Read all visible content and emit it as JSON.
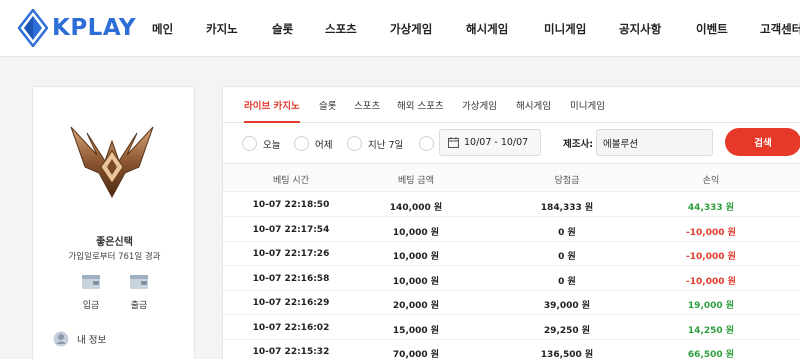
{
  "header": {
    "logo_text": "KPLAY",
    "nav": [
      "메인",
      "카지노",
      "슬롯",
      "스포츠",
      "가상게임",
      "해시게임",
      "미니게임",
      "공지사항",
      "이벤트",
      "고객센터"
    ]
  },
  "profile": {
    "nickname": "좋은신택",
    "since_text": "가입일로부터 761일 경과",
    "deposit_label": "입금",
    "withdraw_label": "출금",
    "my_info_label": "내 정보"
  },
  "tabs": [
    "라이브 카지노",
    "슬롯",
    "스포츠",
    "해외 스포츠",
    "가상게임",
    "해시게임",
    "미니게임"
  ],
  "active_tab": "라이브 카지노",
  "filters": {
    "periods": [
      "오늘",
      "어제",
      "지난 7일",
      ""
    ],
    "date_range": "10/07 - 10/07",
    "maker_label": "제조사:",
    "maker_value": "에볼루션",
    "search_label": "검색"
  },
  "table": {
    "headers": [
      "베팅 시간",
      "베팅 금액",
      "당첨금",
      "손익"
    ],
    "rows": [
      {
        "time": "10-07 22:18:50",
        "bet": "140,000 원",
        "win": "184,333 원",
        "pl": "44,333 원",
        "pl_sign": "pos"
      },
      {
        "time": "10-07 22:17:54",
        "bet": "10,000 원",
        "win": "0 원",
        "pl": "-10,000 원",
        "pl_sign": "neg"
      },
      {
        "time": "10-07 22:17:26",
        "bet": "10,000 원",
        "win": "0 원",
        "pl": "-10,000 원",
        "pl_sign": "neg"
      },
      {
        "time": "10-07 22:16:58",
        "bet": "10,000 원",
        "win": "0 원",
        "pl": "-10,000 원",
        "pl_sign": "neg"
      },
      {
        "time": "10-07 22:16:29",
        "bet": "20,000 원",
        "win": "39,000 원",
        "pl": "19,000 원",
        "pl_sign": "pos"
      },
      {
        "time": "10-07 22:16:02",
        "bet": "15,000 원",
        "win": "29,250 원",
        "pl": "14,250 원",
        "pl_sign": "pos"
      },
      {
        "time": "10-07 22:15:32",
        "bet": "70,000 원",
        "win": "136,500 원",
        "pl": "66,500 원",
        "pl_sign": "pos"
      }
    ]
  },
  "colors": {
    "brand_blue": "#2d6fd6",
    "accent_red": "#e23b2e",
    "profit_green": "#2e9e3f"
  },
  "icons": {
    "logo": "kplay-diamond-logo",
    "rank": "bronze-rank-emblem-icon",
    "deposit": "wallet-in-icon",
    "withdraw": "wallet-out-icon",
    "my_info": "user-icon",
    "calendar": "calendar-icon"
  }
}
